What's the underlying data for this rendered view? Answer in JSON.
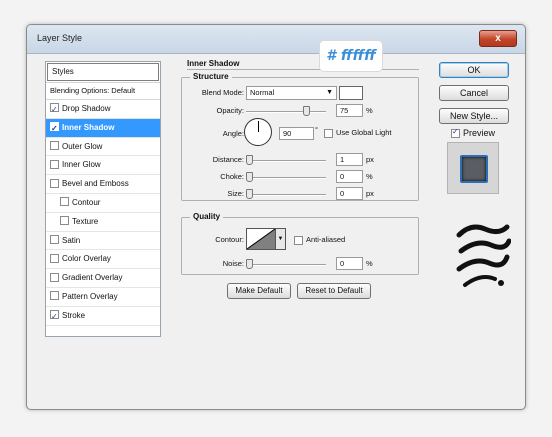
{
  "window": {
    "title": "Layer Style",
    "close_label": "x"
  },
  "badge": {
    "text": "# ffffff"
  },
  "styles_list": {
    "header": "Styles",
    "blending_options": "Blending Options: Default",
    "items": [
      {
        "label": "Drop Shadow",
        "checked": true,
        "active": false,
        "indent": false
      },
      {
        "label": "Inner Shadow",
        "checked": true,
        "active": true,
        "indent": false
      },
      {
        "label": "Outer Glow",
        "checked": false,
        "active": false,
        "indent": false
      },
      {
        "label": "Inner Glow",
        "checked": false,
        "active": false,
        "indent": false
      },
      {
        "label": "Bevel and Emboss",
        "checked": false,
        "active": false,
        "indent": false
      },
      {
        "label": "Contour",
        "checked": false,
        "active": false,
        "indent": true
      },
      {
        "label": "Texture",
        "checked": false,
        "active": false,
        "indent": true
      },
      {
        "label": "Satin",
        "checked": false,
        "active": false,
        "indent": false
      },
      {
        "label": "Color Overlay",
        "checked": false,
        "active": false,
        "indent": false
      },
      {
        "label": "Gradient Overlay",
        "checked": false,
        "active": false,
        "indent": false
      },
      {
        "label": "Pattern Overlay",
        "checked": false,
        "active": false,
        "indent": false
      },
      {
        "label": "Stroke",
        "checked": true,
        "active": false,
        "indent": false
      }
    ]
  },
  "inner_shadow": {
    "section_title": "Inner Shadow",
    "structure": {
      "title": "Structure",
      "blend_mode_label": "Blend Mode:",
      "blend_mode_value": "Normal",
      "blend_color": "#ffffff",
      "opacity_label": "Opacity:",
      "opacity_value": "75",
      "opacity_unit": "%",
      "opacity_fraction": 0.75,
      "angle_label": "Angle:",
      "angle_value": "90",
      "angle_unit": "°",
      "global_light_label": "Use Global Light",
      "global_light_checked": false,
      "distance_label": "Distance:",
      "distance_value": "1",
      "distance_unit": "px",
      "choke_label": "Choke:",
      "choke_value": "0",
      "choke_unit": "%",
      "size_label": "Size:",
      "size_value": "0",
      "size_unit": "px"
    },
    "quality": {
      "title": "Quality",
      "contour_label": "Contour:",
      "anti_aliased_label": "Anti-aliased",
      "anti_aliased_checked": false,
      "noise_label": "Noise:",
      "noise_value": "0",
      "noise_unit": "%"
    },
    "make_default_label": "Make Default",
    "reset_default_label": "Reset to Default"
  },
  "side_buttons": {
    "ok": "OK",
    "cancel": "Cancel",
    "new_style": "New Style...",
    "preview_label": "Preview",
    "preview_checked": true
  },
  "colors": {
    "accent": "#3399ff",
    "close": "#c04428",
    "badge_text": "#3a8fd8"
  },
  "icons": {
    "close": "close-icon",
    "check": "checkmark-icon",
    "dropdown": "chevron-down-icon"
  }
}
